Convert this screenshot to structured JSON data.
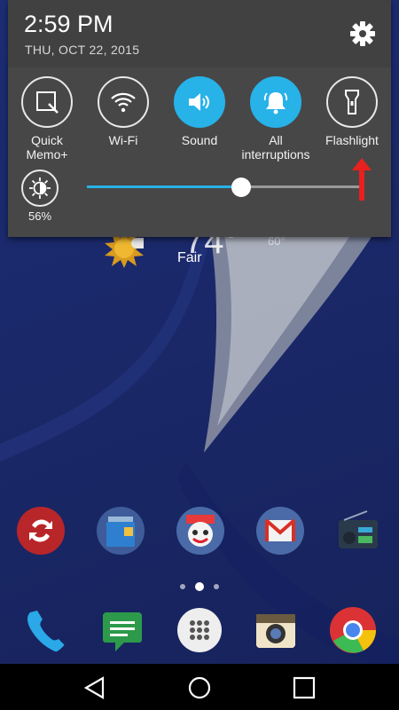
{
  "status": {
    "time": "2:59 PM",
    "date": "THU, OCT 22, 2015"
  },
  "quick_settings": [
    {
      "label": "Quick\nMemo+",
      "icon": "quick-memo-icon",
      "state": "off"
    },
    {
      "label": "Wi-Fi",
      "icon": "wifi-icon",
      "state": "off"
    },
    {
      "label": "Sound",
      "icon": "speaker-icon",
      "state": "on"
    },
    {
      "label": "All\ninterruptions",
      "icon": "bell-icon",
      "state": "on"
    },
    {
      "label": "Flashlight",
      "icon": "flashlight-icon",
      "state": "off"
    }
  ],
  "brightness": {
    "label": "56%",
    "level": 0.56
  },
  "weather": {
    "temp": "74°",
    "condition": "Fair",
    "low": "60°"
  },
  "home": {
    "apps_row": [
      "quick-remote-icon",
      "file-manager-icon",
      "game-app-icon",
      "gmail-icon",
      "radio-icon"
    ],
    "dock": [
      "phone-icon",
      "messaging-icon",
      "apps-drawer-icon",
      "camera-icon",
      "chrome-icon"
    ],
    "page_indicator": {
      "count": 3,
      "active": 1
    }
  },
  "colors": {
    "accent": "#27b2e8",
    "annotation": "#e8211e"
  }
}
